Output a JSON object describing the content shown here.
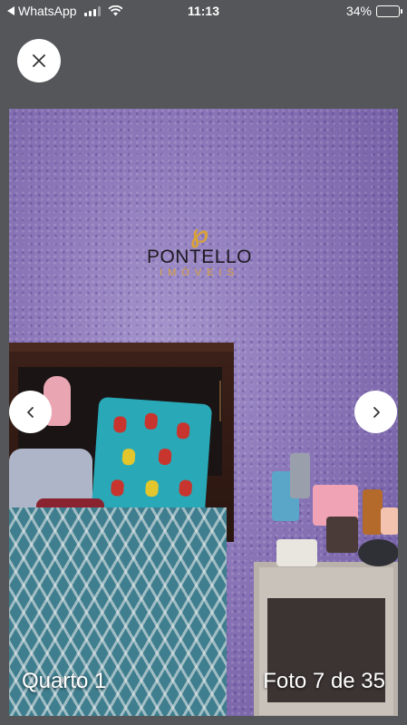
{
  "status_bar": {
    "back_app": "WhatsApp",
    "time": "11:13",
    "battery": "34%",
    "battery_level": 0.34
  },
  "viewer": {
    "close_icon": "close-icon",
    "prev_icon": "chevron-left-icon",
    "next_icon": "chevron-right-icon",
    "room_label": "Quarto 1",
    "photo_counter": "Foto 7 de 35"
  },
  "watermark": {
    "brand": "PONTELLO",
    "sub": "IMÓVEIS"
  },
  "colors": {
    "background": "#555659",
    "wall": "#8b76b8",
    "brand_gold": "#d9a23a"
  }
}
